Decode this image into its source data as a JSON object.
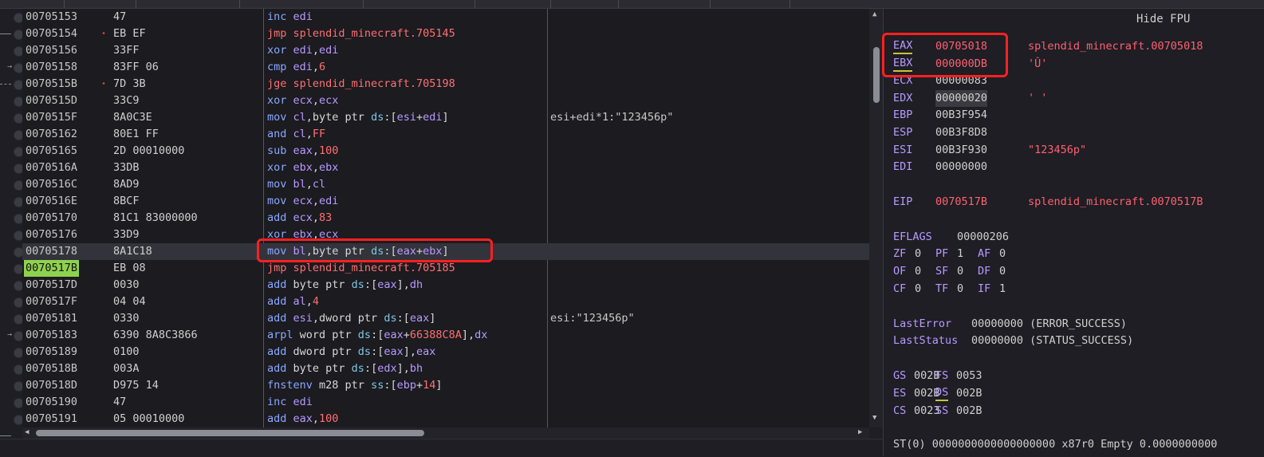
{
  "window": {
    "hide_fpu_label": "Hide FPU"
  },
  "disassembly": {
    "rows": [
      {
        "addr": "00705153",
        "bytes": "47",
        "mn": "inc",
        "ops": [
          [
            "edi",
            "rg"
          ]
        ],
        "cmt": ""
      },
      {
        "addr": "00705154",
        "bytes": "EB EF",
        "mn": "jmp",
        "jump": true,
        "ops": [
          [
            "splendid_minecraft.705145",
            "mj"
          ]
        ],
        "cmt": ""
      },
      {
        "addr": "00705156",
        "bytes": "33FF",
        "mn": "xor",
        "ops": [
          [
            "edi",
            "rg"
          ],
          [
            ",",
            "t"
          ],
          [
            "edi",
            "rg"
          ]
        ],
        "cmt": ""
      },
      {
        "addr": "00705158",
        "bytes": "83FF 06",
        "mn": "cmp",
        "ops": [
          [
            "edi",
            "rg"
          ],
          [
            ",",
            "t"
          ],
          [
            "6",
            "n"
          ]
        ],
        "cmt": ""
      },
      {
        "addr": "0070515B",
        "bytes": "7D 3B",
        "mn": "jge",
        "jump": true,
        "ops": [
          [
            "splendid_minecraft.705198",
            "mj"
          ]
        ],
        "cmt": ""
      },
      {
        "addr": "0070515D",
        "bytes": "33C9",
        "mn": "xor",
        "ops": [
          [
            "ecx",
            "rg"
          ],
          [
            ",",
            "t"
          ],
          [
            "ecx",
            "rg"
          ]
        ],
        "cmt": ""
      },
      {
        "addr": "0070515F",
        "bytes": "8A0C3E",
        "mn": "mov",
        "ops": [
          [
            "cl",
            "rg"
          ],
          [
            ",byte ptr ",
            "t"
          ],
          [
            "ds",
            "seg"
          ],
          [
            ":[",
            "t"
          ],
          [
            "esi",
            "rg"
          ],
          [
            "+",
            "t"
          ],
          [
            "edi",
            "rg"
          ],
          [
            "]",
            "t"
          ]
        ],
        "cmt": "esi+edi*1:\"123456p\""
      },
      {
        "addr": "00705162",
        "bytes": "80E1 FF",
        "mn": "and",
        "ops": [
          [
            "cl",
            "rg"
          ],
          [
            ",",
            "t"
          ],
          [
            "FF",
            "n"
          ]
        ],
        "cmt": ""
      },
      {
        "addr": "00705165",
        "bytes": "2D 00010000",
        "mn": "sub",
        "ops": [
          [
            "eax",
            "rg"
          ],
          [
            ",",
            "t"
          ],
          [
            "100",
            "n"
          ]
        ],
        "cmt": ""
      },
      {
        "addr": "0070516A",
        "bytes": "33DB",
        "mn": "xor",
        "ops": [
          [
            "ebx",
            "rg"
          ],
          [
            ",",
            "t"
          ],
          [
            "ebx",
            "rg"
          ]
        ],
        "cmt": ""
      },
      {
        "addr": "0070516C",
        "bytes": "8AD9",
        "mn": "mov",
        "ops": [
          [
            "bl",
            "rg"
          ],
          [
            ",",
            "t"
          ],
          [
            "cl",
            "rg"
          ]
        ],
        "cmt": ""
      },
      {
        "addr": "0070516E",
        "bytes": "8BCF",
        "mn": "mov",
        "ops": [
          [
            "ecx",
            "rg"
          ],
          [
            ",",
            "t"
          ],
          [
            "edi",
            "rg"
          ]
        ],
        "cmt": ""
      },
      {
        "addr": "00705170",
        "bytes": "81C1 83000000",
        "mn": "add",
        "ops": [
          [
            "ecx",
            "rg"
          ],
          [
            ",",
            "t"
          ],
          [
            "83",
            "n"
          ]
        ],
        "cmt": ""
      },
      {
        "addr": "00705176",
        "bytes": "33D9",
        "mn": "xor",
        "ops": [
          [
            "ebx",
            "rg"
          ],
          [
            ",",
            "t"
          ],
          [
            "ecx",
            "rg"
          ]
        ],
        "cmt": ""
      },
      {
        "addr": "00705178",
        "bytes": "8A1C18",
        "mn": "mov",
        "sel": true,
        "ops": [
          [
            "bl",
            "rg"
          ],
          [
            ",byte ptr ",
            "t"
          ],
          [
            "ds",
            "seg"
          ],
          [
            ":[",
            "t"
          ],
          [
            "eax",
            "rg"
          ],
          [
            "+",
            "t"
          ],
          [
            "ebx",
            "rg"
          ],
          [
            "]",
            "t"
          ]
        ],
        "cmt": ""
      },
      {
        "addr": "0070517B",
        "bytes": "EB 08",
        "mn": "jmp",
        "eip": true,
        "ops": [
          [
            "splendid_minecraft.705185",
            "mj"
          ]
        ],
        "cmt": ""
      },
      {
        "addr": "0070517D",
        "bytes": "0030",
        "mn": "add",
        "ops": [
          [
            "byte ptr ",
            "t"
          ],
          [
            "ds",
            "seg"
          ],
          [
            ":[",
            "t"
          ],
          [
            "eax",
            "rg"
          ],
          [
            "],",
            "t"
          ],
          [
            "dh",
            "rg"
          ]
        ],
        "cmt": ""
      },
      {
        "addr": "0070517F",
        "bytes": "04 04",
        "mn": "add",
        "ops": [
          [
            "al",
            "rg"
          ],
          [
            ",",
            "t"
          ],
          [
            "4",
            "n"
          ]
        ],
        "cmt": ""
      },
      {
        "addr": "00705181",
        "bytes": "0330",
        "mn": "add",
        "ops": [
          [
            "esi",
            "rg"
          ],
          [
            ",dword ptr ",
            "t"
          ],
          [
            "ds",
            "seg"
          ],
          [
            ":[",
            "t"
          ],
          [
            "eax",
            "rg"
          ],
          [
            "]",
            "t"
          ]
        ],
        "cmt": "esi:\"123456p\""
      },
      {
        "addr": "00705183",
        "bytes": "6390 8A8C3866",
        "mn": "arpl",
        "ops": [
          [
            "word ptr ",
            "t"
          ],
          [
            "ds",
            "seg"
          ],
          [
            ":[",
            "t"
          ],
          [
            "eax",
            "rg"
          ],
          [
            "+",
            "t"
          ],
          [
            "66388C8A",
            "n"
          ],
          [
            "],",
            "t"
          ],
          [
            "dx",
            "rg"
          ]
        ],
        "cmt": ""
      },
      {
        "addr": "00705189",
        "bytes": "0100",
        "mn": "add",
        "ops": [
          [
            "dword ptr ",
            "t"
          ],
          [
            "ds",
            "seg"
          ],
          [
            ":[",
            "t"
          ],
          [
            "eax",
            "rg"
          ],
          [
            "],",
            "t"
          ],
          [
            "eax",
            "rg"
          ]
        ],
        "cmt": ""
      },
      {
        "addr": "0070518B",
        "bytes": "003A",
        "mn": "add",
        "ops": [
          [
            "byte ptr ",
            "t"
          ],
          [
            "ds",
            "seg"
          ],
          [
            ":[",
            "t"
          ],
          [
            "edx",
            "rg"
          ],
          [
            "],",
            "t"
          ],
          [
            "bh",
            "rg"
          ]
        ],
        "cmt": ""
      },
      {
        "addr": "0070518D",
        "bytes": "D975 14",
        "mn": "fnstenv",
        "ops": [
          [
            "m28 ptr ",
            "t"
          ],
          [
            "ss",
            "seg"
          ],
          [
            ":[",
            "t"
          ],
          [
            "ebp",
            "rg"
          ],
          [
            "+",
            "t"
          ],
          [
            "14",
            "n"
          ],
          [
            "]",
            "t"
          ]
        ],
        "cmt": ""
      },
      {
        "addr": "00705190",
        "bytes": "47",
        "mn": "inc",
        "ops": [
          [
            "edi",
            "rg"
          ]
        ],
        "cmt": ""
      },
      {
        "addr": "00705191",
        "bytes": "05 00010000",
        "mn": "add",
        "ops": [
          [
            "eax",
            "rg"
          ],
          [
            ",",
            "t"
          ],
          [
            "100",
            "n"
          ]
        ],
        "cmt": ""
      }
    ]
  },
  "registers": {
    "general": [
      {
        "name": "EAX",
        "value": "00705018",
        "comment": "splendid_minecraft.00705018",
        "changed": true,
        "ul": true
      },
      {
        "name": "EBX",
        "value": "000000DB",
        "comment": "'Û'",
        "changed": true,
        "ul": true
      },
      {
        "name": "ECX",
        "value": "00000083",
        "comment": ""
      },
      {
        "name": "EDX",
        "value": "00000020",
        "comment": "' '",
        "boxed": true,
        "plain": true
      },
      {
        "name": "EBP",
        "value": "00B3F954",
        "comment": ""
      },
      {
        "name": "ESP",
        "value": "00B3F8D8",
        "comment": ""
      },
      {
        "name": "ESI",
        "value": "00B3F930",
        "comment": "\"123456p\""
      },
      {
        "name": "EDI",
        "value": "00000000",
        "comment": ""
      }
    ],
    "eip": {
      "name": "EIP",
      "value": "0070517B",
      "comment": "splendid_minecraft.0070517B"
    },
    "eflags": {
      "name": "EFLAGS",
      "value": "00000206"
    },
    "flags": [
      [
        [
          "ZF",
          "0"
        ],
        [
          "PF",
          "1"
        ],
        [
          "AF",
          "0"
        ]
      ],
      [
        [
          "OF",
          "0"
        ],
        [
          "SF",
          "0"
        ],
        [
          "DF",
          "0"
        ]
      ],
      [
        [
          "CF",
          "0"
        ],
        [
          "TF",
          "0"
        ],
        [
          "IF",
          "1"
        ]
      ]
    ],
    "last_error": {
      "name": "LastError",
      "value": "00000000 (ERROR_SUCCESS)"
    },
    "last_status": {
      "name": "LastStatus",
      "value": "00000000 (STATUS_SUCCESS)"
    },
    "segments": [
      [
        [
          "GS",
          "002B"
        ],
        [
          "FS",
          "0053"
        ]
      ],
      [
        [
          "ES",
          "002B"
        ],
        [
          "DS",
          "002B"
        ]
      ],
      [
        [
          "CS",
          "0023"
        ],
        [
          "SS",
          "002B"
        ]
      ]
    ],
    "fpu_first": "ST(0) 0000000000000000000 x87r0 Empty 0.0000000000"
  }
}
